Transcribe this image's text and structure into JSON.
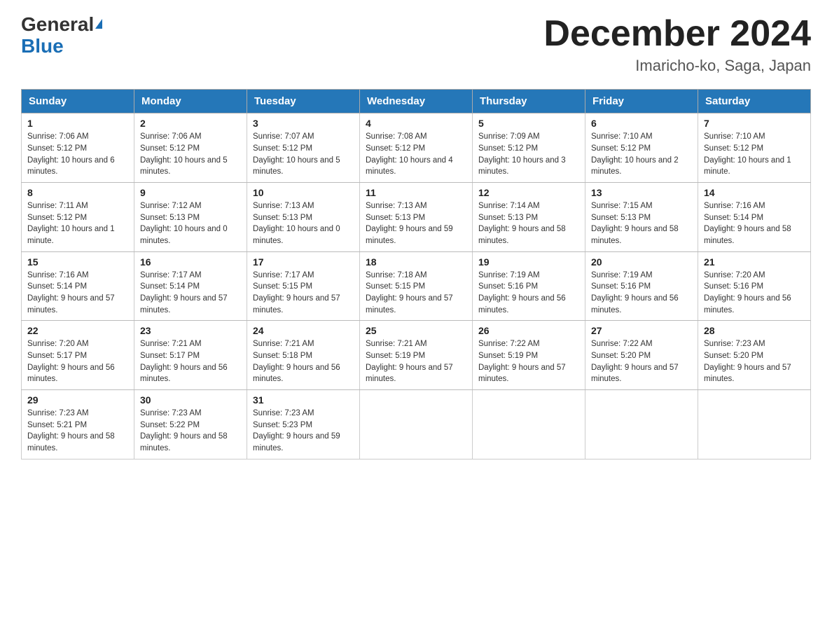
{
  "header": {
    "logo_general": "General",
    "logo_blue": "Blue",
    "month_title": "December 2024",
    "location": "Imaricho-ko, Saga, Japan"
  },
  "weekdays": [
    "Sunday",
    "Monday",
    "Tuesday",
    "Wednesday",
    "Thursday",
    "Friday",
    "Saturday"
  ],
  "weeks": [
    [
      {
        "day": "1",
        "sunrise": "7:06 AM",
        "sunset": "5:12 PM",
        "daylight": "10 hours and 6 minutes."
      },
      {
        "day": "2",
        "sunrise": "7:06 AM",
        "sunset": "5:12 PM",
        "daylight": "10 hours and 5 minutes."
      },
      {
        "day": "3",
        "sunrise": "7:07 AM",
        "sunset": "5:12 PM",
        "daylight": "10 hours and 5 minutes."
      },
      {
        "day": "4",
        "sunrise": "7:08 AM",
        "sunset": "5:12 PM",
        "daylight": "10 hours and 4 minutes."
      },
      {
        "day": "5",
        "sunrise": "7:09 AM",
        "sunset": "5:12 PM",
        "daylight": "10 hours and 3 minutes."
      },
      {
        "day": "6",
        "sunrise": "7:10 AM",
        "sunset": "5:12 PM",
        "daylight": "10 hours and 2 minutes."
      },
      {
        "day": "7",
        "sunrise": "7:10 AM",
        "sunset": "5:12 PM",
        "daylight": "10 hours and 1 minute."
      }
    ],
    [
      {
        "day": "8",
        "sunrise": "7:11 AM",
        "sunset": "5:12 PM",
        "daylight": "10 hours and 1 minute."
      },
      {
        "day": "9",
        "sunrise": "7:12 AM",
        "sunset": "5:13 PM",
        "daylight": "10 hours and 0 minutes."
      },
      {
        "day": "10",
        "sunrise": "7:13 AM",
        "sunset": "5:13 PM",
        "daylight": "10 hours and 0 minutes."
      },
      {
        "day": "11",
        "sunrise": "7:13 AM",
        "sunset": "5:13 PM",
        "daylight": "9 hours and 59 minutes."
      },
      {
        "day": "12",
        "sunrise": "7:14 AM",
        "sunset": "5:13 PM",
        "daylight": "9 hours and 58 minutes."
      },
      {
        "day": "13",
        "sunrise": "7:15 AM",
        "sunset": "5:13 PM",
        "daylight": "9 hours and 58 minutes."
      },
      {
        "day": "14",
        "sunrise": "7:16 AM",
        "sunset": "5:14 PM",
        "daylight": "9 hours and 58 minutes."
      }
    ],
    [
      {
        "day": "15",
        "sunrise": "7:16 AM",
        "sunset": "5:14 PM",
        "daylight": "9 hours and 57 minutes."
      },
      {
        "day": "16",
        "sunrise": "7:17 AM",
        "sunset": "5:14 PM",
        "daylight": "9 hours and 57 minutes."
      },
      {
        "day": "17",
        "sunrise": "7:17 AM",
        "sunset": "5:15 PM",
        "daylight": "9 hours and 57 minutes."
      },
      {
        "day": "18",
        "sunrise": "7:18 AM",
        "sunset": "5:15 PM",
        "daylight": "9 hours and 57 minutes."
      },
      {
        "day": "19",
        "sunrise": "7:19 AM",
        "sunset": "5:16 PM",
        "daylight": "9 hours and 56 minutes."
      },
      {
        "day": "20",
        "sunrise": "7:19 AM",
        "sunset": "5:16 PM",
        "daylight": "9 hours and 56 minutes."
      },
      {
        "day": "21",
        "sunrise": "7:20 AM",
        "sunset": "5:16 PM",
        "daylight": "9 hours and 56 minutes."
      }
    ],
    [
      {
        "day": "22",
        "sunrise": "7:20 AM",
        "sunset": "5:17 PM",
        "daylight": "9 hours and 56 minutes."
      },
      {
        "day": "23",
        "sunrise": "7:21 AM",
        "sunset": "5:17 PM",
        "daylight": "9 hours and 56 minutes."
      },
      {
        "day": "24",
        "sunrise": "7:21 AM",
        "sunset": "5:18 PM",
        "daylight": "9 hours and 56 minutes."
      },
      {
        "day": "25",
        "sunrise": "7:21 AM",
        "sunset": "5:19 PM",
        "daylight": "9 hours and 57 minutes."
      },
      {
        "day": "26",
        "sunrise": "7:22 AM",
        "sunset": "5:19 PM",
        "daylight": "9 hours and 57 minutes."
      },
      {
        "day": "27",
        "sunrise": "7:22 AM",
        "sunset": "5:20 PM",
        "daylight": "9 hours and 57 minutes."
      },
      {
        "day": "28",
        "sunrise": "7:23 AM",
        "sunset": "5:20 PM",
        "daylight": "9 hours and 57 minutes."
      }
    ],
    [
      {
        "day": "29",
        "sunrise": "7:23 AM",
        "sunset": "5:21 PM",
        "daylight": "9 hours and 58 minutes."
      },
      {
        "day": "30",
        "sunrise": "7:23 AM",
        "sunset": "5:22 PM",
        "daylight": "9 hours and 58 minutes."
      },
      {
        "day": "31",
        "sunrise": "7:23 AM",
        "sunset": "5:23 PM",
        "daylight": "9 hours and 59 minutes."
      },
      null,
      null,
      null,
      null
    ]
  ],
  "labels": {
    "sunrise": "Sunrise:",
    "sunset": "Sunset:",
    "daylight": "Daylight:"
  }
}
